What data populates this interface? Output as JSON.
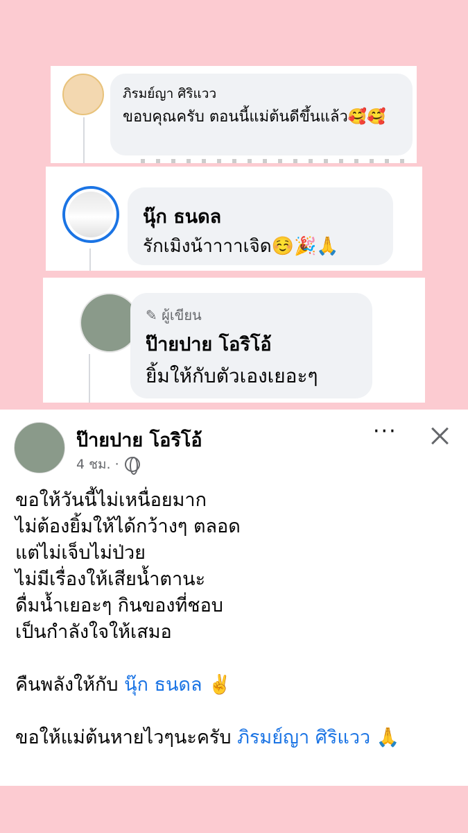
{
  "comment1": {
    "author": "ภิรมย์ญา ศิริแวว",
    "text": "ขอบคุณครับ ตอนนี้แม่ต้นดีขึ้นแล้ว🥰🥰"
  },
  "comment2": {
    "author": "นุ๊ก ธนดล",
    "text": "รักเมิงน้าาาาเจิด☺️🎉🙏"
  },
  "comment3": {
    "badge": "✎ ผู้เขียน",
    "author": "ป๊ายปาย โอริโอ้",
    "text": "ยิ้มให้กับตัวเองเยอะๆ"
  },
  "post": {
    "author": "ป๊ายปาย โอริโอ้",
    "time": "4 ชม. ·",
    "more_label": "···",
    "lines": [
      "ขอให้วันนี้ไม่เหนื่อยมาก",
      "ไม่ต้องยิ้มให้ได้กว้างๆ ตลอด",
      "แต่ไม่เจ็บไม่ป่วย",
      "ไม่มีเรื่องให้เสียน้ำตานะ",
      "ดื่มน้ำเยอะๆ กินของที่ชอบ",
      "เป็นกำลังใจให้เสมอ"
    ],
    "line_power_prefix": "คืนพลังให้กับ ",
    "line_power_mention": "นุ๊ก ธนดล",
    "line_power_suffix": " ✌️",
    "line_wish_prefix": "ขอให้แม่ต้นหายไวๆนะครับ ",
    "line_wish_mention": "ภิรมย์ญา ศิริแวว",
    "line_wish_suffix": " 🙏"
  }
}
